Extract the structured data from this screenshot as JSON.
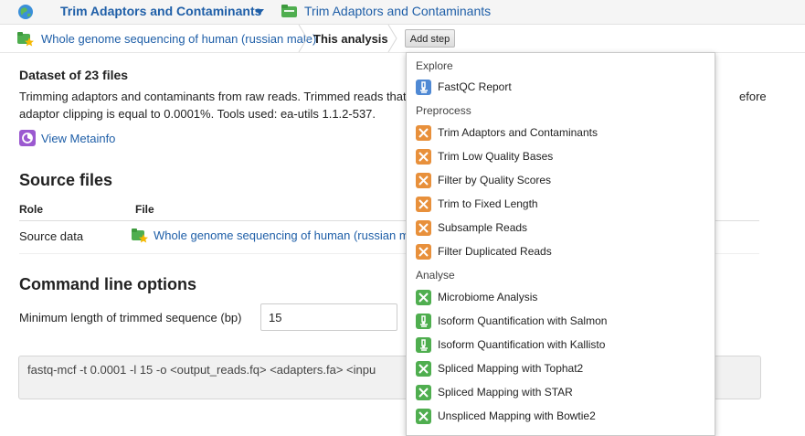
{
  "topbar": {
    "app_title": "Trim Adaptors and Contaminants",
    "tool_link": "Trim Adaptors and Contaminants"
  },
  "breadcrumb": {
    "item1": "Whole genome sequencing of human (russian male)",
    "item2": "This analysis",
    "add_step": "Add step"
  },
  "dataset": {
    "title": "Dataset of 23 files",
    "description": "Trimming adaptors and contaminants from raw reads. Trimmed reads that … before adaptor clipping is equal to 0.0001%. Tools used: ea-utils 1.1.2-537.",
    "desc_line1": "Trimming adaptors and contaminants from raw reads. Trimmed reads that",
    "desc_line1_tail": "efore",
    "desc_line2": "adaptor clipping is equal to 0.0001%. Tools used: ea-utils 1.1.2-537.",
    "view_metainfo": "View Metainfo"
  },
  "source_files": {
    "heading": "Source files",
    "columns": [
      "Role",
      "File"
    ],
    "rows": [
      {
        "role": "Source data",
        "file": "Whole genome sequencing of human (russian m"
      }
    ]
  },
  "command_line": {
    "heading": "Command line options",
    "min_length_label": "Minimum length of trimmed sequence (bp)",
    "min_length_value": "15",
    "command": "fastq-mcf -t 0.0001 -l 15 -o <output_reads.fq> <adapters.fa> <inpu"
  },
  "add_step_menu": {
    "explore_header": "Explore",
    "explore": [
      "FastQC Report"
    ],
    "preprocess_header": "Preprocess",
    "preprocess": [
      "Trim Adaptors and Contaminants",
      "Trim Low Quality Bases",
      "Filter by Quality Scores",
      "Trim to Fixed Length",
      "Subsample Reads",
      "Filter Duplicated Reads"
    ],
    "analyse_header": "Analyse",
    "analyse": [
      "Microbiome Analysis",
      "Isoform Quantification with Salmon",
      "Isoform Quantification with Kallisto",
      "Spliced Mapping with Tophat2",
      "Spliced Mapping with STAR",
      "Unspliced Mapping with Bowtie2"
    ]
  },
  "colors": {
    "link": "#1f5fa8",
    "explore_icon": "#4f89d4",
    "preprocess_icon": "#e8903b",
    "analyse_icon": "#4fae4f"
  }
}
